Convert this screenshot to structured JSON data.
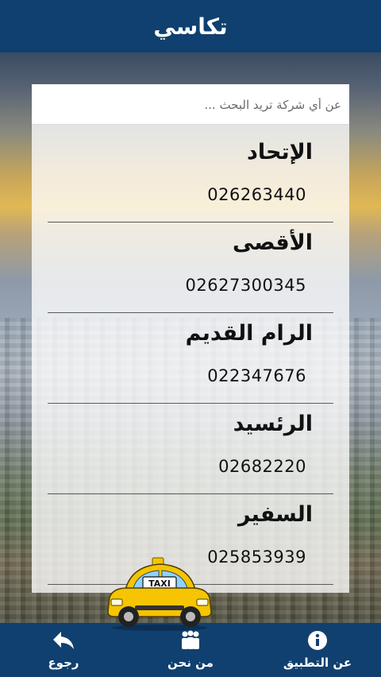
{
  "header": {
    "title": "تكاسي"
  },
  "search": {
    "placeholder": "عن أي شركة تريد البحث ..."
  },
  "companies": [
    {
      "name": "الإتحاد",
      "phone": "026263440"
    },
    {
      "name": "الأقصى",
      "phone": "02627300345"
    },
    {
      "name": "الرام القديم",
      "phone": "022347676"
    },
    {
      "name": "الرئسيد",
      "phone": "02682220"
    },
    {
      "name": "السفير",
      "phone": "025853939"
    }
  ],
  "taxi": {
    "sign": "TAXI"
  },
  "bottom_nav": {
    "back_label": "رجوع",
    "about_us_label": "من نحن",
    "about_app_label": "عن التطبيق"
  },
  "colors": {
    "bar": "#10406f",
    "taxi_yellow": "#f6c400"
  },
  "icons": {
    "back": "back-arrow-icon",
    "about_us": "people-icon",
    "about_app": "info-icon"
  }
}
